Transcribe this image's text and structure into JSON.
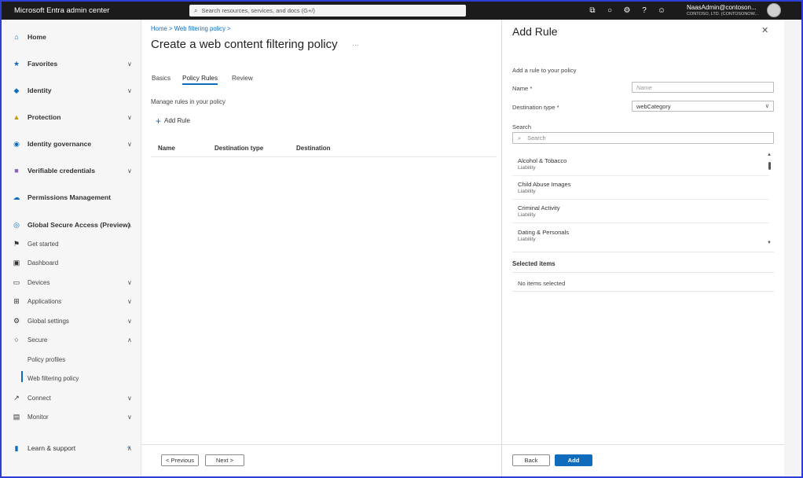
{
  "topbar": {
    "app_title": "Microsoft Entra admin center",
    "search_placeholder": "Search resources, services, and docs (G+/)",
    "user_name": "NaasAdmin@contoson...",
    "user_org": "CONTOSO, LTD. (CONTOSONOW...",
    "icons": [
      "copilot-icon",
      "bell-icon",
      "gear-icon",
      "help-icon",
      "feedback-icon"
    ]
  },
  "sidebar": {
    "items": [
      {
        "label": "Home",
        "icon": "home-icon"
      },
      {
        "label": "Favorites",
        "icon": "star-icon"
      },
      {
        "label": "Identity",
        "icon": "diamond-icon"
      },
      {
        "label": "Protection",
        "icon": "user-shield-icon"
      },
      {
        "label": "Identity governance",
        "icon": "governance-icon"
      },
      {
        "label": "Verifiable credentials",
        "icon": "credentials-icon"
      },
      {
        "label": "Permissions Management",
        "icon": "cloud-icon"
      },
      {
        "label": "Global Secure Access (Preview)",
        "icon": "globe-icon"
      },
      {
        "label": "Get started",
        "icon": "flag-icon"
      },
      {
        "label": "Dashboard",
        "icon": "dashboard-icon"
      },
      {
        "label": "Devices",
        "icon": "devices-icon"
      },
      {
        "label": "Applications",
        "icon": "apps-icon"
      },
      {
        "label": "Global settings",
        "icon": "settings-icon"
      },
      {
        "label": "Secure",
        "icon": "lock-icon"
      },
      {
        "label": "Policy profiles",
        "icon": ""
      },
      {
        "label": "Web filtering policy",
        "icon": ""
      },
      {
        "label": "Connect",
        "icon": "connect-icon"
      },
      {
        "label": "Monitor",
        "icon": "monitor-icon"
      },
      {
        "label": "Learn & support",
        "icon": "person-icon"
      }
    ],
    "collapse_glyph": "«"
  },
  "main": {
    "breadcrumb": "Home > Web filtering policy >",
    "title": "Create a web content filtering policy",
    "more_glyph": "···",
    "tabs": [
      {
        "label": "Basics"
      },
      {
        "label": "Policy Rules"
      },
      {
        "label": "Review"
      }
    ],
    "manage_text": "Manage rules in your policy",
    "add_rule_label": "Add Rule",
    "columns": [
      "Name",
      "Destination type",
      "Destination"
    ],
    "prev_label": "< Previous",
    "next_label": "Next >"
  },
  "panel": {
    "title": "Add Rule",
    "subtitle": "Add a rule to your policy",
    "name_label": "Name *",
    "name_placeholder": "Name",
    "dest_type_label": "Destination type *",
    "dest_type_value": "webCategory",
    "search_label": "Search",
    "search_placeholder": "Search",
    "categories": [
      {
        "name": "Alcohol & Tobacco",
        "group": "Liability"
      },
      {
        "name": "Child Abuse Images",
        "group": "Liability"
      },
      {
        "name": "Criminal Activity",
        "group": "Liability"
      },
      {
        "name": "Dating & Personals",
        "group": "Liability"
      }
    ],
    "selected_title": "Selected items",
    "no_items": "No items selected",
    "back_label": "Back",
    "add_label": "Add"
  }
}
